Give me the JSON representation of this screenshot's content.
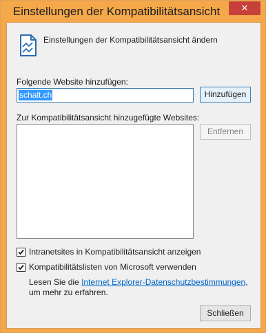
{
  "window": {
    "title": "Einstellungen der Kompatibilitätsansicht",
    "close_glyph": "✕"
  },
  "header": {
    "icon": "compatibility-view-icon",
    "text": "Einstellungen der Kompatibilitätsansicht ändern"
  },
  "add_site": {
    "label": "Folgende Website hinzufügen:",
    "input_value": "schalt.ch",
    "add_button": "Hinzufügen"
  },
  "sites_list": {
    "label": "Zur Kompatibilitätsansicht hinzugefügte Websites:",
    "items": [],
    "remove_button": "Entfernen"
  },
  "options": {
    "intranet": {
      "label": "Intranetsites in Kompatibilitätsansicht anzeigen",
      "checked": true
    },
    "microsoft_lists": {
      "label": "Kompatibilitätslisten von Microsoft verwenden",
      "checked": true
    }
  },
  "info": {
    "prefix": "Lesen Sie die ",
    "link": "Internet Explorer-Datenschutzbestimmungen",
    "suffix": ", um mehr zu erfahren."
  },
  "footer": {
    "close_button": "Schließen"
  },
  "colors": {
    "frame": "#f5a84a",
    "close": "#c7413a",
    "link": "#0066cc",
    "selection": "#3399ff"
  }
}
